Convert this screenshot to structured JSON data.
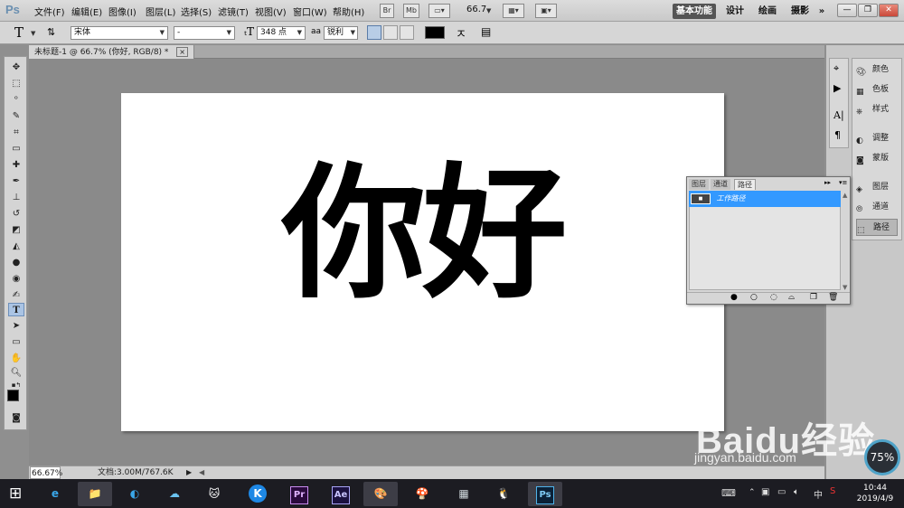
{
  "app": {
    "logo": "Ps"
  },
  "menubar": {
    "items": [
      "文件(F)",
      "编辑(E)",
      "图像(I)",
      "图层(L)",
      "选择(S)",
      "滤镜(T)",
      "视图(V)",
      "窗口(W)",
      "帮助(H)"
    ],
    "br_label": "Br",
    "mb_label": "Mb",
    "zoom": "66.7",
    "workspaces": [
      "基本功能",
      "设计",
      "绘画",
      "摄影"
    ],
    "more": "»"
  },
  "options": {
    "tool_glyph": "T",
    "font_family": "宋体",
    "font_style": "-",
    "font_size": "348 点",
    "aa_icon": "aa",
    "antialias": "锐利",
    "color": "#000000"
  },
  "document": {
    "tab_title": "未标题-1 @ 66.7% (你好, RGB/8) *",
    "tab_close": "×",
    "canvas_text": "你好"
  },
  "status": {
    "zoom": "66.67%",
    "doc_info": "文档:3.00M/767.6K"
  },
  "dock": {
    "items": [
      "颜色",
      "色板",
      "样式",
      "调整",
      "蒙版",
      "图层",
      "通道",
      "路径"
    ]
  },
  "paths_panel": {
    "tabs": [
      "图层",
      "通道",
      "路径"
    ],
    "row_label": "工作路径"
  },
  "taskbar": {
    "time": "10:44",
    "date": "2019/4/9",
    "ime": "中",
    "apps": [
      "e",
      "📁",
      "◐",
      "☁",
      "🐱",
      "K",
      "Pr",
      "Ae",
      "🎨",
      "🍄",
      "▦",
      "🐧",
      "Ps"
    ]
  },
  "watermark": {
    "brand": "Baidu经验",
    "url": "jingyan.baidu.com",
    "gauge": "75%"
  }
}
